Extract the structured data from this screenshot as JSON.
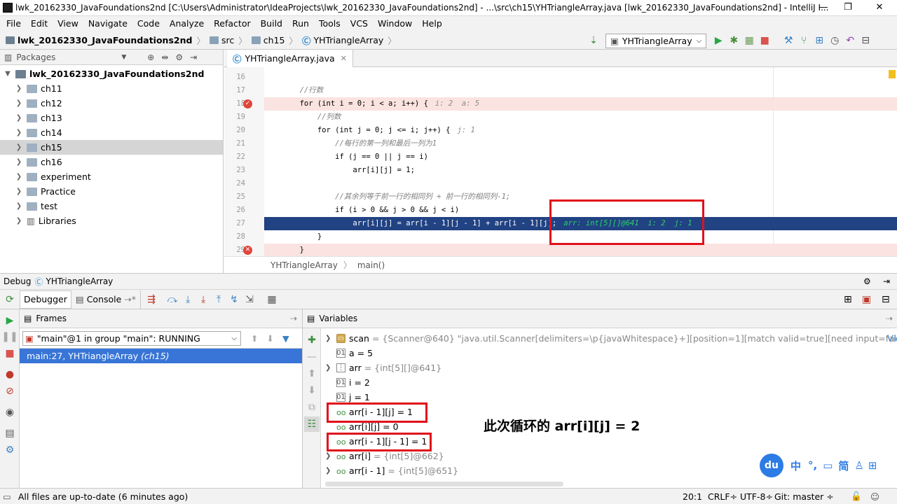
{
  "title": "lwk_20162330_JavaFoundations2nd [C:\\Users\\Administrator\\IdeaProjects\\lwk_20162330_JavaFoundations2nd] - ...\\src\\ch15\\YHTriangleArray.java [lwk_20162330_JavaFoundations2nd] - IntelliJ I...",
  "menu": [
    "File",
    "Edit",
    "View",
    "Navigate",
    "Code",
    "Analyze",
    "Refactor",
    "Build",
    "Run",
    "Tools",
    "VCS",
    "Window",
    "Help"
  ],
  "breadcrumb": [
    "lwk_20162330_JavaFoundations2nd",
    "src",
    "ch15",
    "YHTriangleArray"
  ],
  "run_config": "YHTriangleArray",
  "project_panel": {
    "view": "Packages",
    "root": "lwk_20162330_JavaFoundations2nd",
    "items": [
      "ch11",
      "ch12",
      "ch13",
      "ch14",
      "ch15",
      "ch16",
      "experiment",
      "Practice",
      "test",
      "Libraries"
    ],
    "selected": "ch15"
  },
  "editor": {
    "tab": "YHTriangleArray.java",
    "lines": [
      {
        "n": "16",
        "code": ""
      },
      {
        "n": "17",
        "code": "        //行数"
      },
      {
        "n": "18",
        "code": "        for (int i = 0; i < a; i++) {",
        "hint": "i: 2  a: 5"
      },
      {
        "n": "19",
        "code": "            //列数"
      },
      {
        "n": "20",
        "code": "            for (int j = 0; j <= i; j++) {",
        "hint": "j: 1"
      },
      {
        "n": "21",
        "code": "                //每行的第一列和最后一列为1"
      },
      {
        "n": "22",
        "code": "                if (j == 0 || j == i)"
      },
      {
        "n": "23",
        "code": "                    arr[i][j] = 1;"
      },
      {
        "n": "24",
        "code": ""
      },
      {
        "n": "25",
        "code": "                //其余列等于前一行的相同列 + 前一行的相同列-1;"
      },
      {
        "n": "26",
        "code": "                if (i > 0 && j > 0 && j < i)"
      },
      {
        "n": "27",
        "code": "                    arr[i][j] = arr[i - 1][j - 1] + arr[i - 1][j];",
        "hint": "arr: int[5][]@641  i: 2  j: 1"
      },
      {
        "n": "28",
        "code": "            }"
      },
      {
        "n": "29",
        "code": "        }"
      }
    ],
    "footer": [
      "YHTriangleArray",
      "main()"
    ]
  },
  "debug": {
    "title": "Debug",
    "config": "YHTriangleArray",
    "tabs": [
      "Debugger",
      "Console"
    ],
    "frames_label": "Frames",
    "thread": "\"main\"@1 in group \"main\": RUNNING",
    "frame": "main:27, YHTriangleArray",
    "frame_pkg": "(ch15)",
    "variables_label": "Variables",
    "variables": [
      {
        "name": "scan",
        "value": "= {Scanner@640} \"java.util.Scanner[delimiters=\\p{javaWhitespace}+][position=1][match valid=true][need input=false][sou...",
        "link": "View"
      },
      {
        "name": "a",
        "value": "= 5"
      },
      {
        "name": "arr",
        "value": "= {int[5][]@641}"
      },
      {
        "name": "i",
        "value": "= 2"
      },
      {
        "name": "j",
        "value": "= 1"
      },
      {
        "name": "arr[i - 1][j]",
        "value": "= 1"
      },
      {
        "name": "arr[i][j]",
        "value": "= 0"
      },
      {
        "name": "arr[i - 1][j - 1]",
        "value": "= 1"
      },
      {
        "name": "arr[i]",
        "value": "= {int[5]@662}"
      },
      {
        "name": "arr[i - 1]",
        "value": "= {int[5]@651}"
      }
    ],
    "annotation": "此次循环的 arr[i][j] = 2"
  },
  "ime": [
    "du",
    "中",
    "°,",
    "简"
  ],
  "status": {
    "message": "All files are up-to-date (6 minutes ago)",
    "pos": "20:1",
    "crlf": "CRLF÷",
    "enc": "UTF-8÷",
    "git": "Git: master ÷"
  },
  "colors": {
    "execution_line": "#214283",
    "breakpoint_line": "#fae3e0",
    "red_box": "#e0101a",
    "selection": "#3875d7"
  }
}
